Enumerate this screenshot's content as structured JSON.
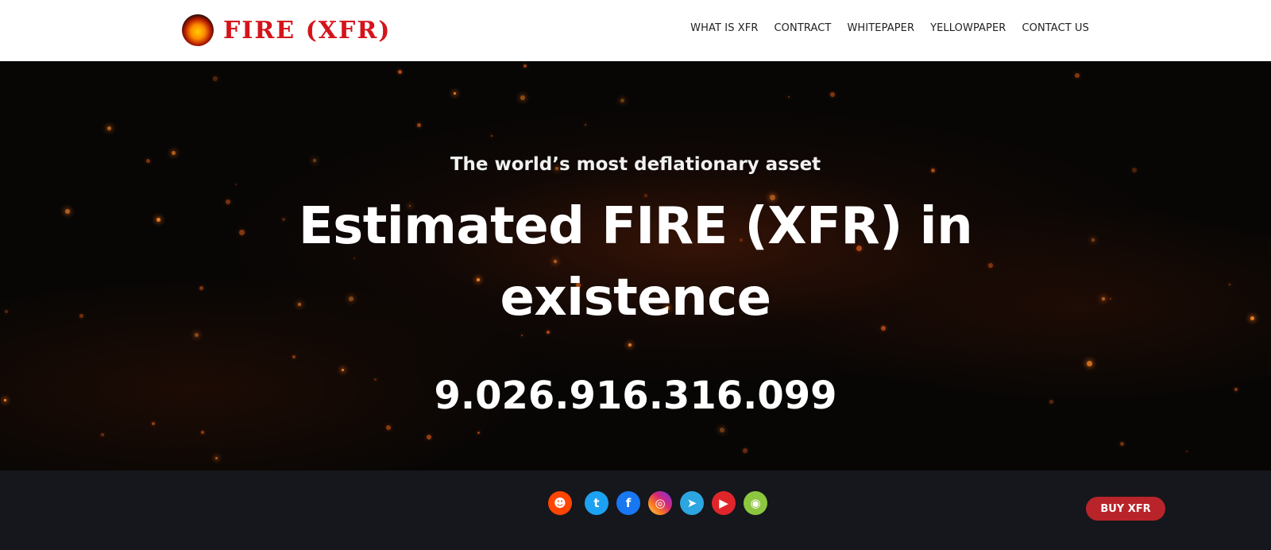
{
  "header": {
    "logo_text": "FIRE (XFR)",
    "nav": [
      {
        "label": "WHAT IS XFR"
      },
      {
        "label": "CONTRACT"
      },
      {
        "label": "WHITEPAPER"
      },
      {
        "label": "YELLOWPAPER"
      },
      {
        "label": "CONTACT US"
      }
    ]
  },
  "hero": {
    "tagline": "The world’s most deflationary asset",
    "headline_line1": "Estimated FIRE (XFR) in",
    "headline_line2": "existence",
    "counter": "9.026.916.316.099"
  },
  "footer": {
    "socials": [
      {
        "name": "reddit-icon",
        "glyph": "☻"
      },
      {
        "name": "twitter-icon",
        "glyph": "t"
      },
      {
        "name": "facebook-icon",
        "glyph": "f"
      },
      {
        "name": "instagram-icon",
        "glyph": "◎"
      },
      {
        "name": "telegram-icon",
        "glyph": "➤"
      },
      {
        "name": "youtube-icon",
        "glyph": "▶"
      },
      {
        "name": "coingecko-icon",
        "glyph": "◉"
      }
    ],
    "buy_label": "BUY XFR"
  },
  "colors": {
    "brand_red": "#d4141a",
    "button_red": "#b9242a",
    "footer_bg": "#15171c",
    "header_bg": "#ffffff",
    "spark_orange": "#ff8a2a"
  }
}
